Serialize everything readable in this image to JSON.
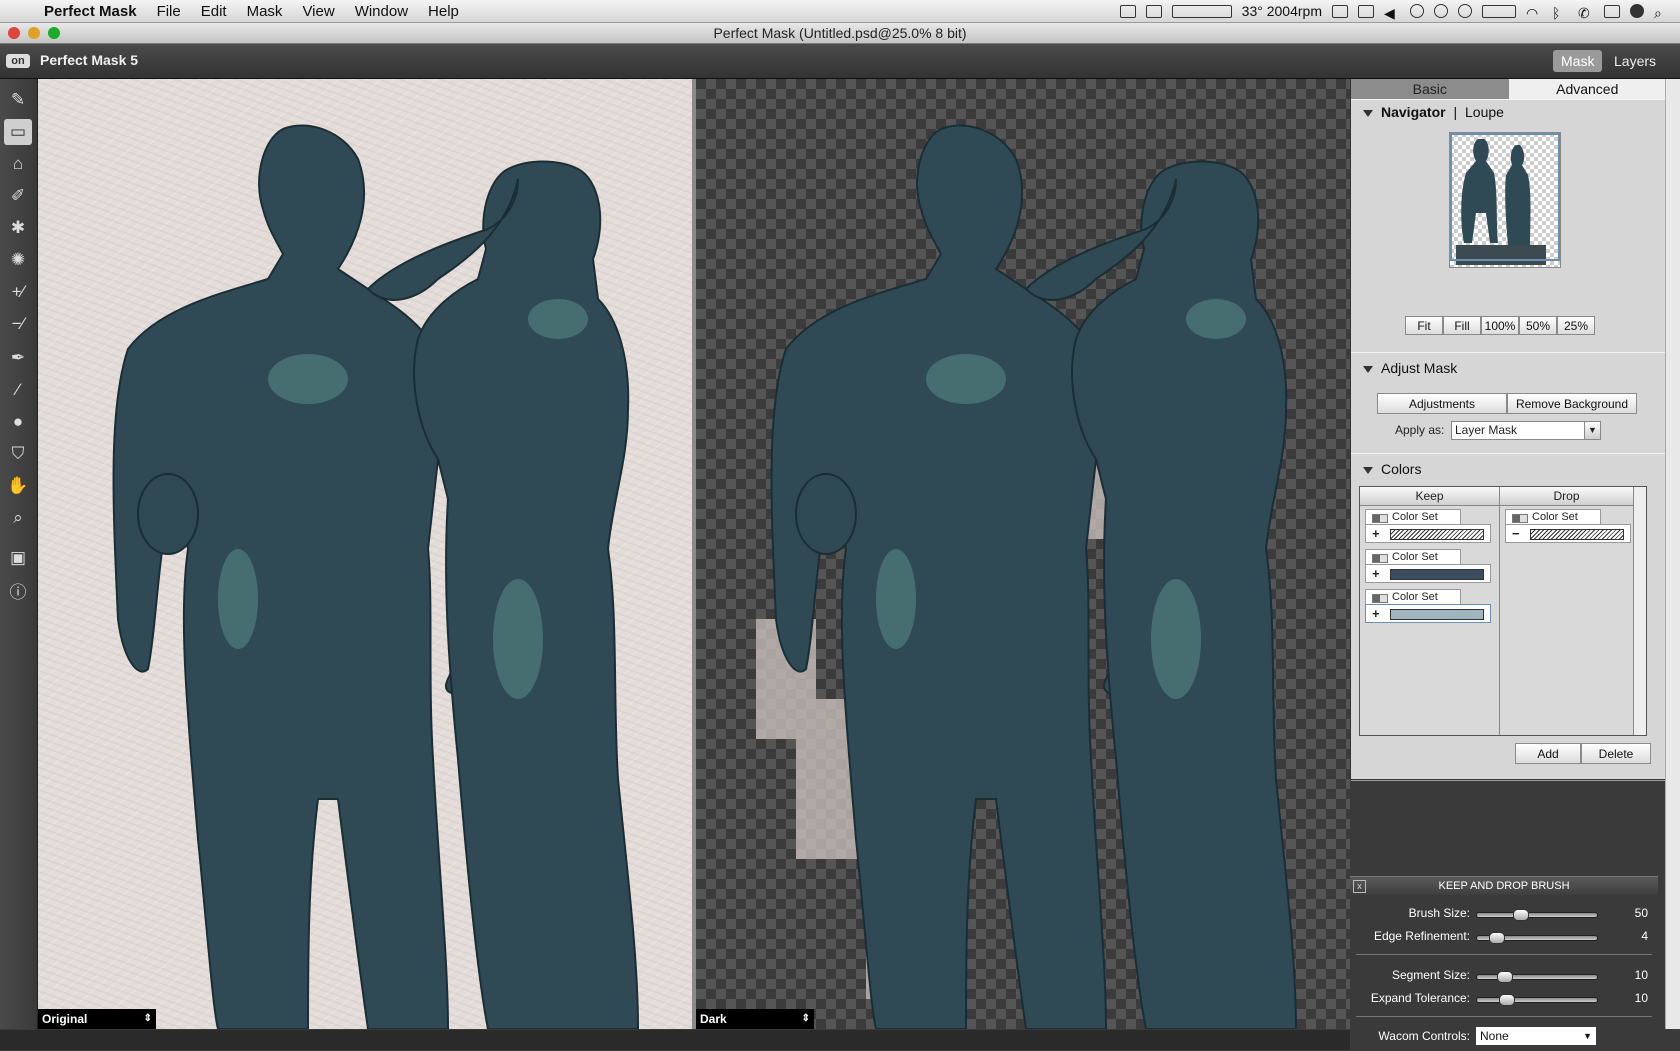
{
  "menubar": {
    "app_name": "Perfect Mask",
    "items": [
      "File",
      "Edit",
      "Mask",
      "View",
      "Window",
      "Help"
    ],
    "status_text": "33° 2004rpm"
  },
  "window": {
    "title": "Perfect Mask (Untitled.psd@25.0% 8 bit)"
  },
  "header": {
    "logo": "on",
    "title": "Perfect Mask 5",
    "mask_label": "Mask",
    "layers_label": "Layers"
  },
  "panes": {
    "left_view": "Original",
    "right_view": "Dark"
  },
  "panel": {
    "tabs": {
      "basic": "Basic",
      "advanced": "Advanced"
    },
    "navigator": {
      "title": "Navigator",
      "sep": "|",
      "loupe": "Loupe",
      "zoom_buttons": [
        "Fit",
        "Fill",
        "100%",
        "50%",
        "25%"
      ]
    },
    "adjust_mask": {
      "title": "Adjust Mask",
      "adjustments_label": "Adjustments",
      "remove_bg_label": "Remove Background",
      "apply_as_label": "Apply as:",
      "apply_as_value": "Layer Mask"
    },
    "colors": {
      "title": "Colors",
      "keep_header": "Keep",
      "drop_header": "Drop",
      "keep_sets": [
        {
          "label": "Color Set",
          "sign": "+"
        },
        {
          "label": "Color Set",
          "sign": "+"
        },
        {
          "label": "Color Set",
          "sign": "+"
        }
      ],
      "drop_sets": [
        {
          "label": "Color Set",
          "sign": "−"
        }
      ],
      "add_label": "Add",
      "delete_label": "Delete"
    }
  },
  "brush": {
    "title": "KEEP AND DROP BRUSH",
    "close": "x",
    "brush_size": {
      "label": "Brush Size:",
      "value": "50"
    },
    "edge_refinement": {
      "label": "Edge Refinement:",
      "value": "4"
    },
    "segment_size": {
      "label": "Segment Size:",
      "value": "10"
    },
    "expand_tolerance": {
      "label": "Expand Tolerance:",
      "value": "10"
    },
    "wacom": {
      "label": "Wacom Controls:",
      "value": "None"
    }
  },
  "colors_accent": {
    "panel_bg": "#d6d6d6",
    "app_dark": "#3a3a3a",
    "statue": "#2f4a55"
  }
}
